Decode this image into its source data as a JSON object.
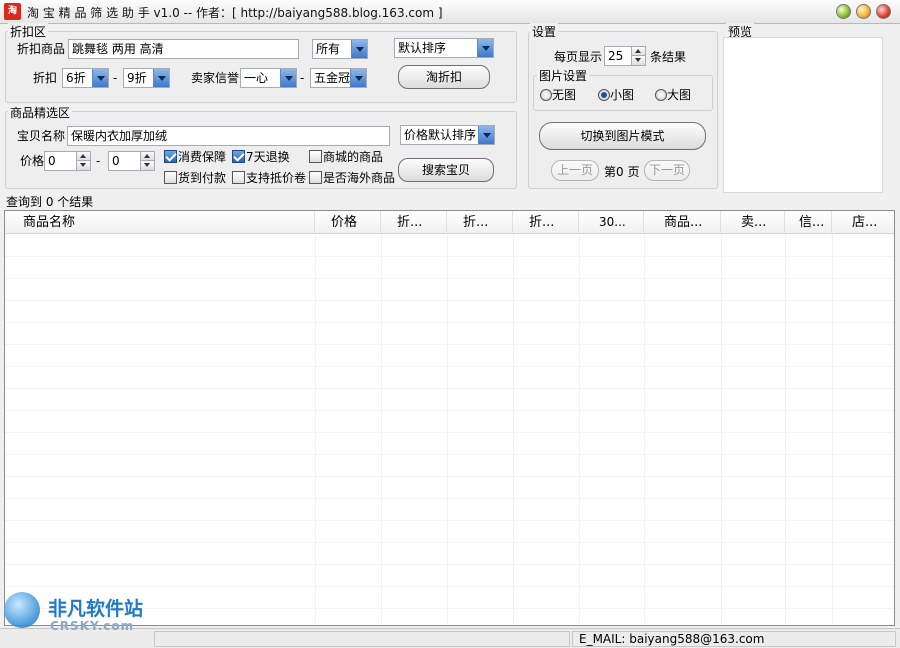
{
  "window": {
    "icon_text": "淘",
    "title": "淘 宝 精 品 筛 选 助 手 v1.0 --  作者：[  http://baiyang588.blog.163.com  ]"
  },
  "discount_group": {
    "title": "折扣区",
    "product_label": "折扣商品",
    "product_value": "跳舞毯 两用 高清",
    "scope_value": "所有",
    "sort_value": "默认排序",
    "discount_label": "折扣",
    "discount_from": "6折",
    "discount_to": "9折",
    "range_sep": "-",
    "credit_label": "卖家信誉",
    "credit_from": "一心",
    "credit_to": "五金冠",
    "search_button": "淘折扣"
  },
  "filter_group": {
    "title": "商品精选区",
    "name_label": "宝贝名称",
    "name_value": "保暖内衣加厚加绒",
    "sort_value": "价格默认排序",
    "price_label": "价格",
    "price_from": "0",
    "price_to": "0",
    "range_sep": "-",
    "checkboxes": [
      {
        "label": "消费保障",
        "checked": true
      },
      {
        "label": "7天退换",
        "checked": true
      },
      {
        "label": "商城的商品",
        "checked": false
      },
      {
        "label": "货到付款",
        "checked": false
      },
      {
        "label": "支持抵价卷",
        "checked": false
      },
      {
        "label": "是否海外商品",
        "checked": false
      }
    ],
    "search_button": "搜索宝贝"
  },
  "settings_group": {
    "title": "设置",
    "per_page_label": "每页显示",
    "per_page_value": "25",
    "per_page_suffix": "条结果",
    "image_group_title": "图片设置",
    "radios": [
      {
        "label": "无图",
        "selected": false
      },
      {
        "label": "小图",
        "selected": true
      },
      {
        "label": "大图",
        "selected": false
      }
    ],
    "switch_button": "切换到图片模式",
    "prev_button": "上一页",
    "page_text": "第0 页",
    "next_button": "下一页"
  },
  "preview_group": {
    "title": "预览"
  },
  "results": {
    "summary": "查询到 0 个结果",
    "columns": [
      "商品名称",
      "价格",
      "折...",
      "折...",
      "折...",
      "30...",
      "商品...",
      "卖...",
      "信...",
      "店..."
    ]
  },
  "status": {
    "email": "E_MAIL: baiyang588@163.com"
  },
  "watermark": {
    "title": "非凡软件站",
    "subtitle": "CRSKY.com"
  }
}
